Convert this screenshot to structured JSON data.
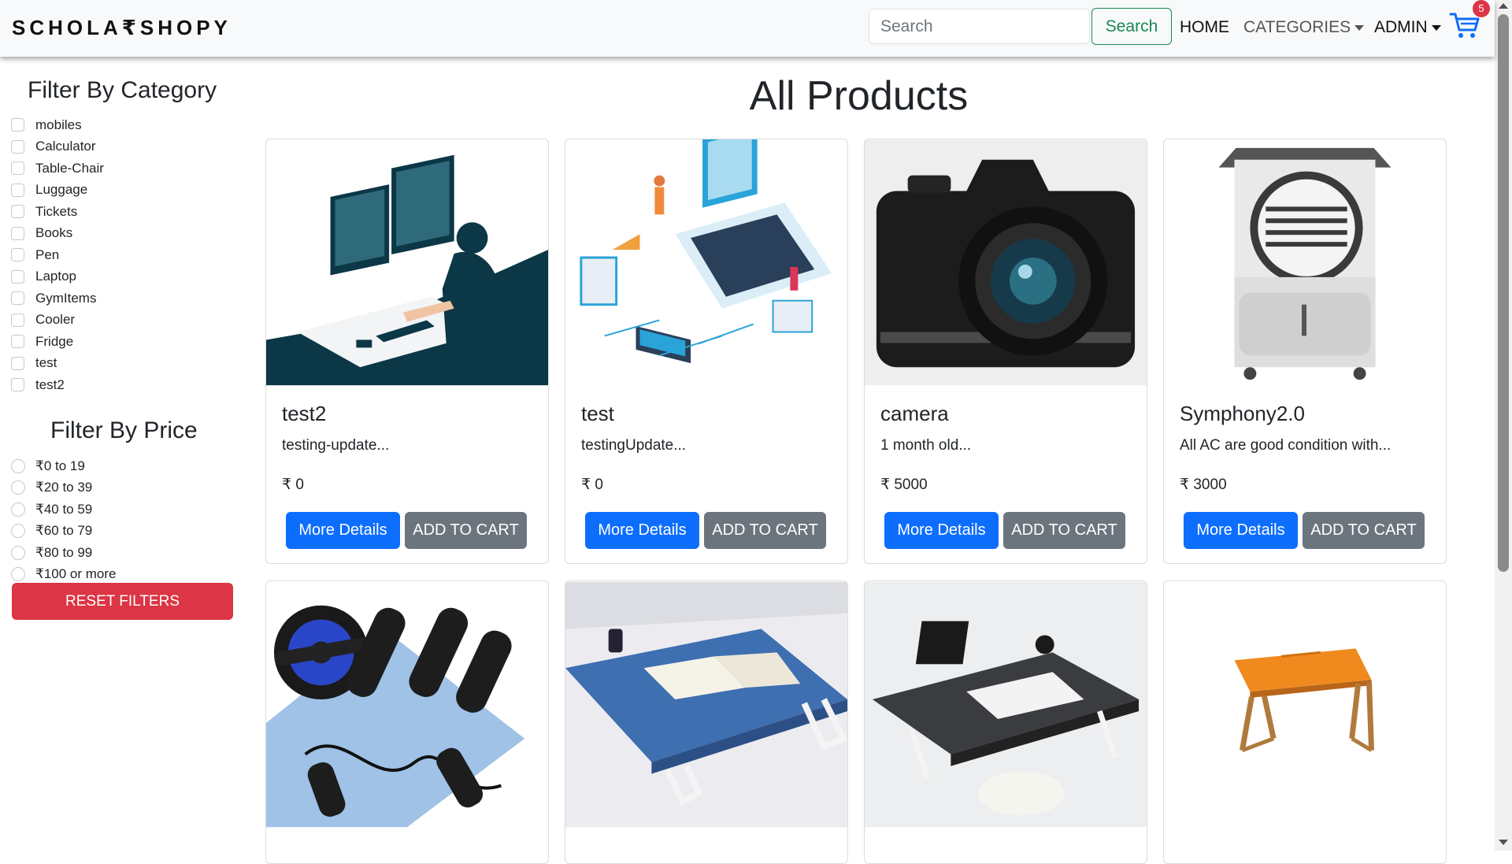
{
  "navbar": {
    "brand": "SCHOLA₹SHOPY",
    "search_placeholder": "Search",
    "search_button": "Search",
    "home": "HOME",
    "categories": "CATEGORIES",
    "admin": "ADMIN",
    "cart_count": "5"
  },
  "sidebar": {
    "category_title": "Filter By Category",
    "categories": [
      "mobiles",
      "Calculator",
      "Table-Chair",
      "Luggage",
      "Tickets",
      "Books",
      "Pen",
      "Laptop",
      "GymItems",
      "Cooler",
      "Fridge",
      "test",
      "test2"
    ],
    "price_title": "Filter By Price",
    "prices": [
      "₹0 to 19",
      "₹20 to 39",
      "₹40 to 59",
      "₹60 to 79",
      "₹80 to 99",
      "₹100 or more"
    ],
    "reset_button": "RESET FILTERS"
  },
  "main": {
    "title": "All Products",
    "products": [
      {
        "name": "test2",
        "description": "testing-update...",
        "price": "₹ 0",
        "details_button": "More Details",
        "cart_button": "ADD TO CART"
      },
      {
        "name": "test",
        "description": "testingUpdate...",
        "price": "₹ 0",
        "details_button": "More Details",
        "cart_button": "ADD TO CART"
      },
      {
        "name": "camera",
        "description": "1 month old...",
        "price": "₹ 5000",
        "details_button": "More Details",
        "cart_button": "ADD TO CART"
      },
      {
        "name": "Symphony2.0",
        "description": "All AC are good condition with...",
        "price": "₹ 3000",
        "details_button": "More Details",
        "cart_button": "ADD TO CART"
      }
    ]
  },
  "colors": {
    "primary": "#0d6efd",
    "secondary": "#6c757d",
    "danger": "#dc3545",
    "success": "#198754",
    "navbar_bg": "#f8f9fa"
  }
}
